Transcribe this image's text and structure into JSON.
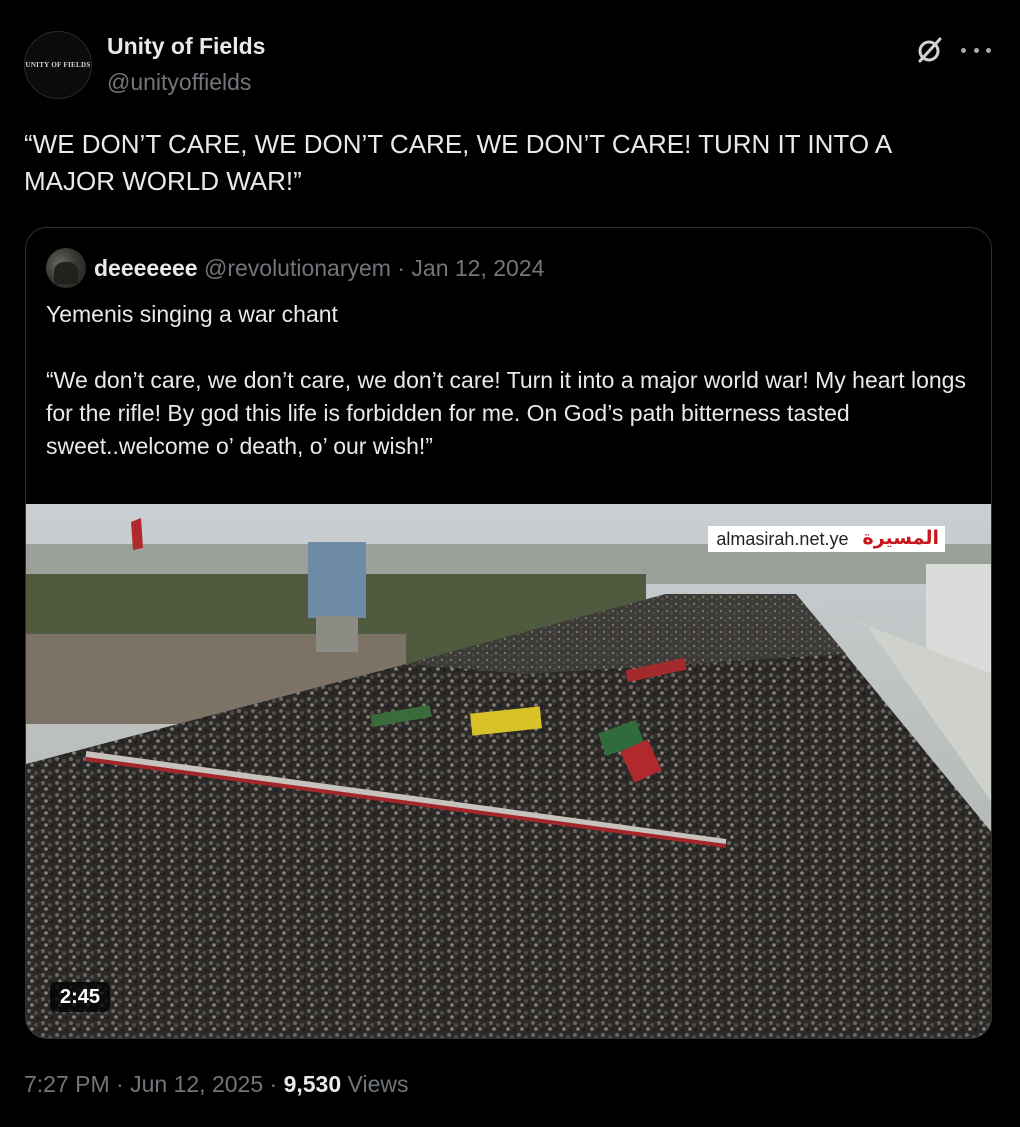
{
  "author": {
    "display_name": "Unity of Fields",
    "handle": "@unityoffields",
    "avatar_text": "UNITY OF FIELDS"
  },
  "tweet": {
    "text": "“WE DON’T CARE, WE DON’T CARE, WE DON’T CARE! TURN IT INTO A MAJOR WORLD WAR!”",
    "time": "7:27 PM",
    "separator": "·",
    "date": "Jun 12, 2025",
    "views_count": "9,530",
    "views_label": "Views"
  },
  "quote": {
    "display_name": "deeeeeee",
    "handle": "@revolutionaryem",
    "separator": "·",
    "date": "Jan 12, 2024",
    "text": "Yemenis singing a war chant\n\n“We don’t care, we don’t care, we don’t care! Turn it into a major world war! My heart longs for the rifle! By god this life is forbidden for me. On God’s path bitterness tasted sweet..welcome o’ death, o’ our wish!”",
    "media": {
      "watermark_site": "almasirah.net.ye",
      "watermark_logo": "المسيرة",
      "duration": "2:45"
    }
  },
  "icons": {
    "grok": "grok-icon",
    "more": "more-icon"
  },
  "colors": {
    "background": "#000000",
    "text_primary": "#e7e9ea",
    "text_secondary": "#71767b",
    "border": "#2f3336",
    "watermark_red": "#c8161d"
  }
}
